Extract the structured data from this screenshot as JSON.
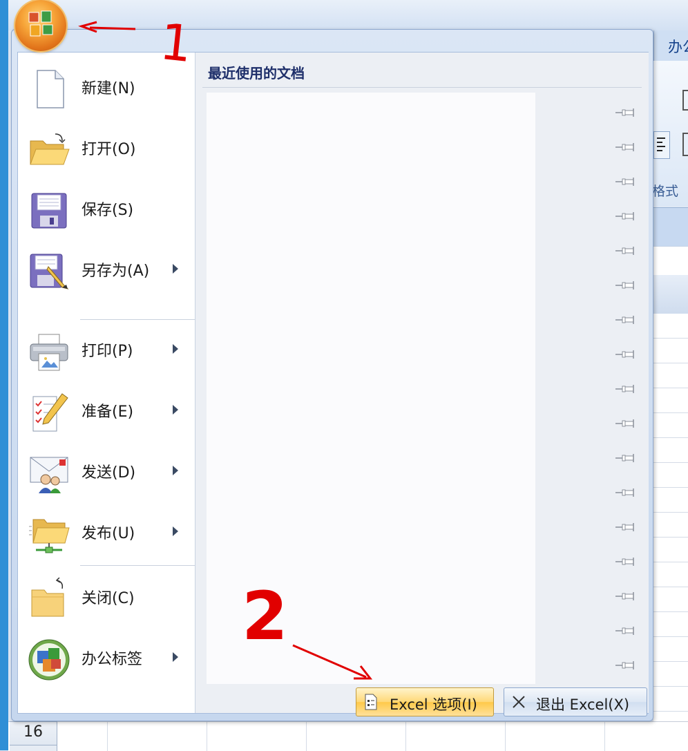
{
  "app": {
    "title": "Excel"
  },
  "background": {
    "ribbon_tab_label": "办公",
    "ribbon_group_label": "格式",
    "row_number": "16"
  },
  "office_menu": {
    "commands": [
      {
        "label": "新建(N)",
        "icon": "new-document-icon",
        "has_submenu": false
      },
      {
        "label": "打开(O)",
        "icon": "open-folder-icon",
        "has_submenu": false
      },
      {
        "label": "保存(S)",
        "icon": "save-floppy-icon",
        "has_submenu": false
      },
      {
        "label": "另存为(A)",
        "icon": "save-as-icon",
        "has_submenu": true
      },
      {
        "label": "打印(P)",
        "icon": "printer-icon",
        "has_submenu": true
      },
      {
        "label": "准备(E)",
        "icon": "prepare-checklist-icon",
        "has_submenu": true
      },
      {
        "label": "发送(D)",
        "icon": "send-mail-icon",
        "has_submenu": true
      },
      {
        "label": "发布(U)",
        "icon": "publish-folder-icon",
        "has_submenu": true
      },
      {
        "label": "关闭(C)",
        "icon": "close-folder-icon",
        "has_submenu": false
      },
      {
        "label": "办公标签",
        "icon": "office-tab-icon",
        "has_submenu": true
      }
    ],
    "recent_documents": {
      "title": "最近使用的文档",
      "pin_count": 17
    },
    "footer": {
      "options_button": "Excel 选项(I)",
      "exit_button": "退出 Excel(X)"
    }
  },
  "annotations": {
    "step1": "1",
    "step2": "2"
  },
  "colors": {
    "annotation_red": "#e10000",
    "menu_border": "#8da7cd",
    "title_blue": "#1e2f6a"
  }
}
